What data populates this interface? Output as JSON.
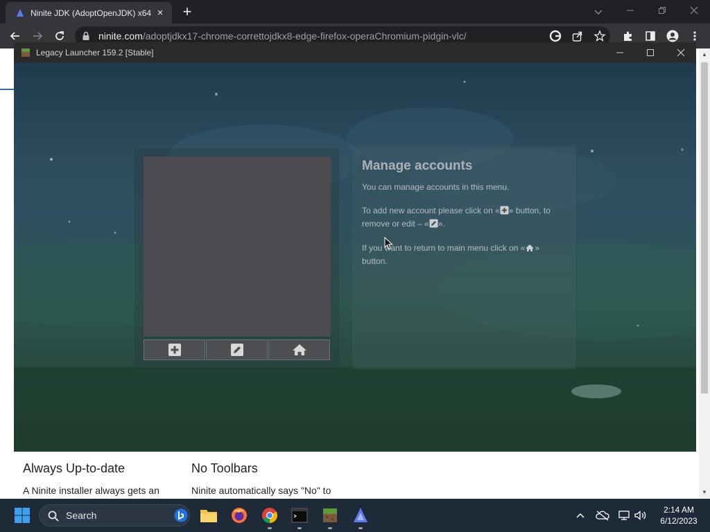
{
  "browser": {
    "tab_title": "Ninite JDK (AdoptOpenJDK) x64",
    "url_host": "ninite.com",
    "url_path": "/adoptjdkx17-chrome-correttojdkx8-edge-firefox-operaChromium-pidgin-vlc/"
  },
  "page": {
    "features": [
      {
        "title": "Always Up-to-date",
        "text": "A Ninite installer always gets an"
      },
      {
        "title": "No Toolbars",
        "text": "Ninite automatically says \"No\" to"
      }
    ]
  },
  "launcher": {
    "title": "Legacy Launcher 159.2 [Stable]",
    "info": {
      "heading": "Manage accounts",
      "line1": "You can manage accounts in this menu.",
      "line2_a": "To add new account please click on «",
      "line2_b": "» button, to remove or edit – «",
      "line2_c": "».",
      "line3_a": "If you want to return to main menu click on «",
      "line3_b": "» button."
    },
    "buttons": {
      "add": "plus-icon",
      "edit": "pencil-icon",
      "home": "home-icon"
    }
  },
  "taskbar": {
    "search_label": "Search",
    "time": "2:14 AM",
    "date": "6/12/2023"
  },
  "colors": {
    "tab_bg": "#35363a",
    "titlebar_bg": "#202124",
    "launcher_panel": "#4a4c4f",
    "taskbar_bg": "#1f2a38"
  }
}
